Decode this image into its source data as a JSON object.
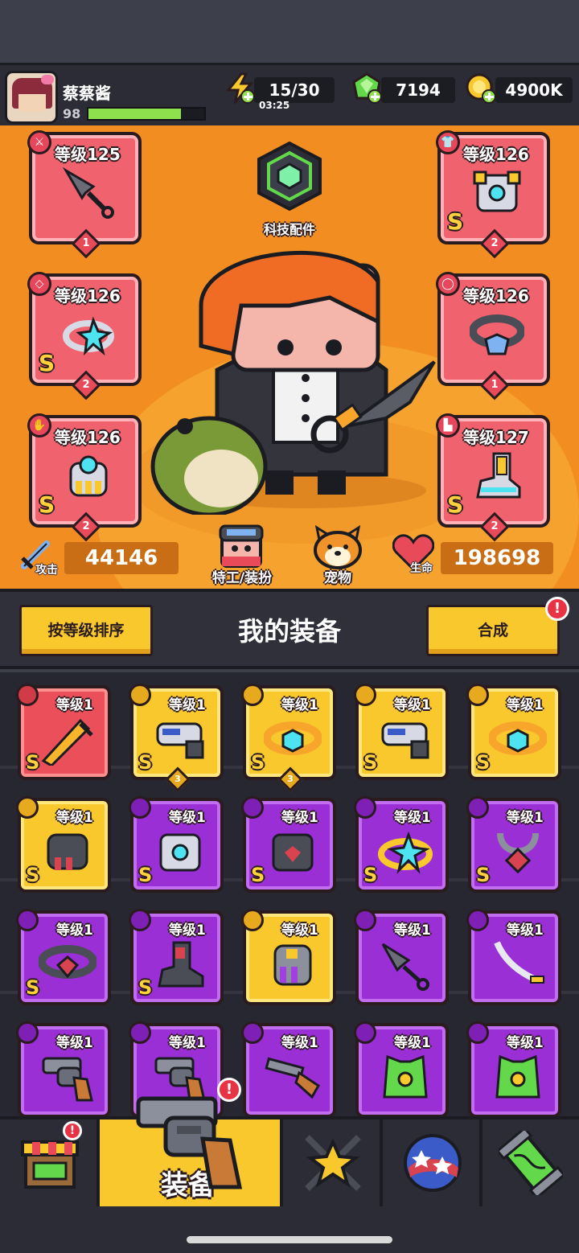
{
  "header": {
    "player_name": "蔡蔡酱",
    "player_level": "98",
    "xp_fraction": 0.8,
    "energy": "15/30",
    "energy_timer": "03:25",
    "gems": "7194",
    "gold": "4900K"
  },
  "hero": {
    "tech_parts_label": "科技配件",
    "slots": {
      "weapon": {
        "level": "等级125",
        "count": "1"
      },
      "armor": {
        "level": "等级126",
        "count": "2"
      },
      "ring": {
        "level": "等级126",
        "count": "2"
      },
      "belt": {
        "level": "等级126",
        "count": "1"
      },
      "gloves": {
        "level": "等级126",
        "count": "2"
      },
      "boots": {
        "level": "等级127",
        "count": "2"
      }
    },
    "attack_label": "攻击",
    "attack_value": "44146",
    "agent_label": "特工/装扮",
    "pet_label": "宠物",
    "hp_label": "生命",
    "hp_value": "198698"
  },
  "equipment": {
    "sort_button": "按等级排序",
    "title": "我的装备",
    "merge_button": "合成",
    "alert_mark": "!",
    "s_rank": "S",
    "items": [
      {
        "level": "等级1",
        "rarity": "red",
        "icon": "blade",
        "s": true,
        "count": ""
      },
      {
        "level": "等级1",
        "rarity": "gold",
        "icon": "blaster",
        "s": true,
        "count": "3"
      },
      {
        "level": "等级1",
        "rarity": "gold",
        "icon": "belt",
        "s": true,
        "count": "3"
      },
      {
        "level": "等级1",
        "rarity": "gold",
        "icon": "blaster",
        "s": true,
        "count": ""
      },
      {
        "level": "等级1",
        "rarity": "gold",
        "icon": "belt",
        "s": true,
        "count": ""
      },
      {
        "level": "等级1",
        "rarity": "gold",
        "icon": "gauntlet",
        "s": true,
        "count": ""
      },
      {
        "level": "等级1",
        "rarity": "purple",
        "icon": "armor",
        "s": true,
        "count": ""
      },
      {
        "level": "等级1",
        "rarity": "purple",
        "icon": "dark-armor",
        "s": true,
        "count": ""
      },
      {
        "level": "等级1",
        "rarity": "purple",
        "icon": "ring",
        "s": true,
        "count": ""
      },
      {
        "level": "等级1",
        "rarity": "purple",
        "icon": "necklace",
        "s": true,
        "count": ""
      },
      {
        "level": "等级1",
        "rarity": "purple",
        "icon": "dark-belt",
        "s": true,
        "count": ""
      },
      {
        "level": "等级1",
        "rarity": "purple",
        "icon": "boots",
        "s": true,
        "count": ""
      },
      {
        "level": "等级1",
        "rarity": "gold",
        "icon": "glove",
        "s": false,
        "count": ""
      },
      {
        "level": "等级1",
        "rarity": "purple",
        "icon": "kunai",
        "s": false,
        "count": ""
      },
      {
        "level": "等级1",
        "rarity": "purple",
        "icon": "katana",
        "s": false,
        "count": ""
      },
      {
        "level": "等级1",
        "rarity": "purple",
        "icon": "revolver",
        "s": false,
        "count": ""
      },
      {
        "level": "等级1",
        "rarity": "purple",
        "icon": "revolver",
        "s": false,
        "count": ""
      },
      {
        "level": "等级1",
        "rarity": "purple",
        "icon": "shotgun",
        "s": false,
        "count": ""
      },
      {
        "level": "等级1",
        "rarity": "purple",
        "icon": "vest",
        "s": false,
        "count": ""
      },
      {
        "level": "等级1",
        "rarity": "purple",
        "icon": "vest",
        "s": false,
        "count": ""
      }
    ]
  },
  "nav": {
    "equipment_label": "装备",
    "tabs": [
      "shop",
      "equipment",
      "talents",
      "planet",
      "dna"
    ]
  },
  "colors": {
    "hero_bg": "#f28d21",
    "accent_yellow": "#f8c82c",
    "rarity_red": "#ea4f5a",
    "rarity_gold": "#f8c82c",
    "rarity_purple": "#9a2fd6"
  }
}
